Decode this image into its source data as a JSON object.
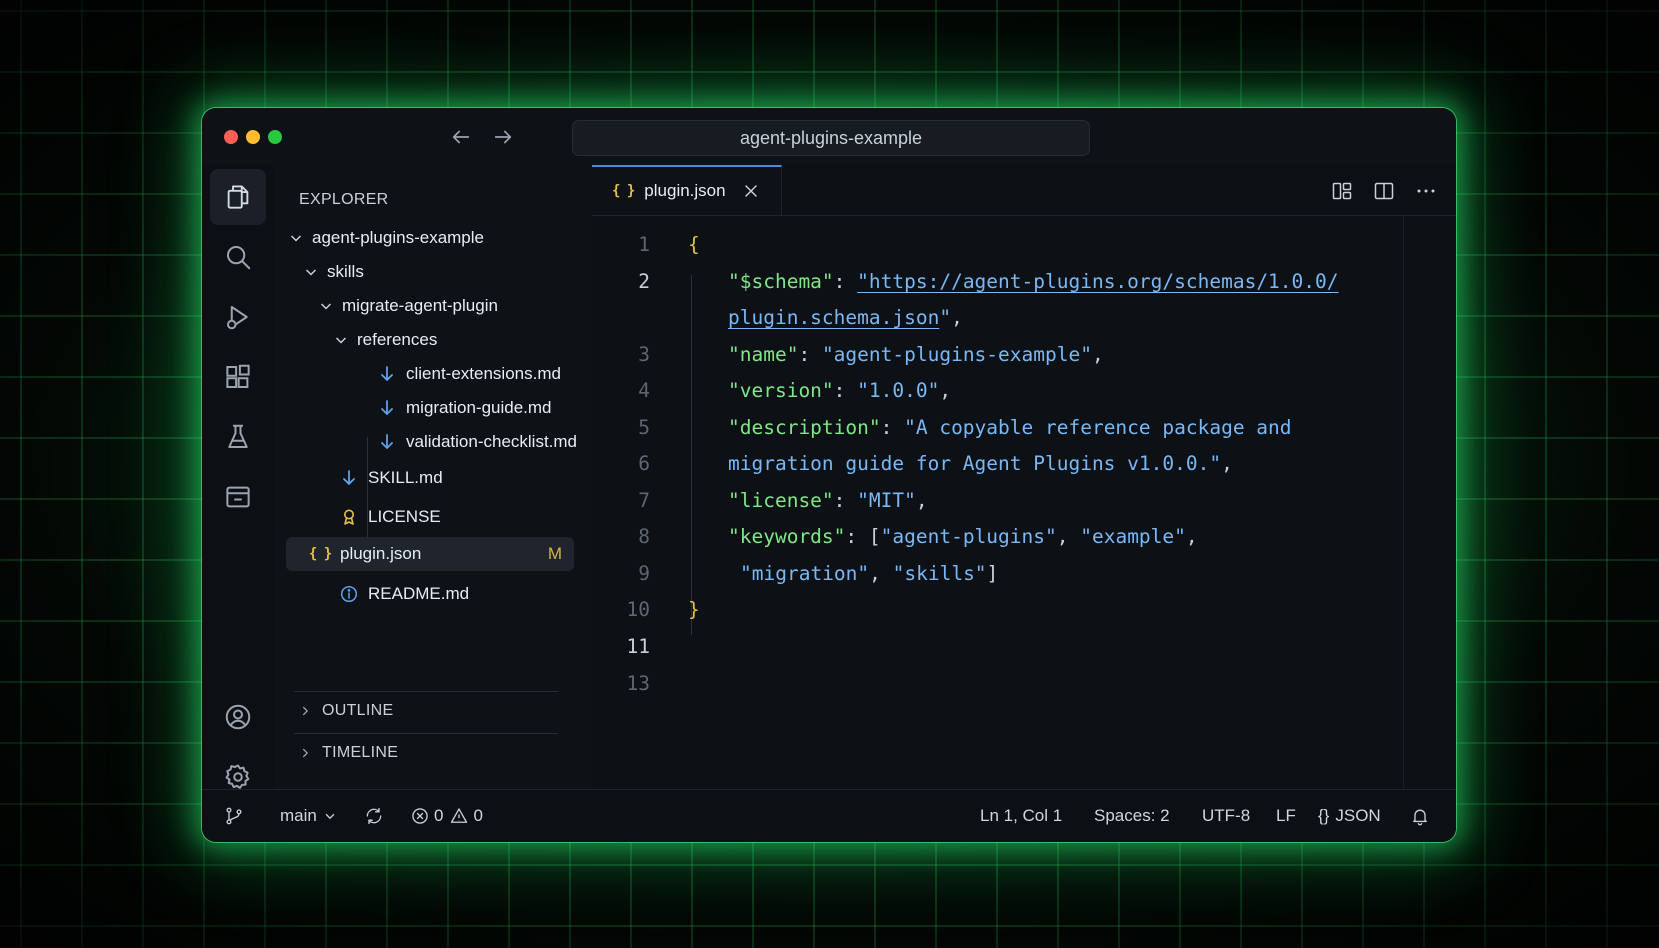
{
  "window": {
    "title": "agent-plugins-example"
  },
  "sidebar": {
    "title": "EXPLORER",
    "tree": [
      {
        "label": "agent-plugins-example",
        "kind": "folder"
      },
      {
        "label": "skills",
        "kind": "folder"
      },
      {
        "label": "migrate-agent-plugin",
        "kind": "folder"
      },
      {
        "label": "references",
        "kind": "folder"
      },
      {
        "label": "client-extensions.md",
        "kind": "markdown"
      },
      {
        "label": "migration-guide.md",
        "kind": "markdown"
      },
      {
        "label": "validation-checklist.md",
        "kind": "markdown"
      },
      {
        "label": "SKILL.md",
        "kind": "markdown"
      },
      {
        "label": "LICENSE",
        "kind": "license"
      },
      {
        "label": "plugin.json",
        "kind": "json",
        "status": "M"
      },
      {
        "label": "README.md",
        "kind": "info"
      }
    ],
    "sections": {
      "outline": "OUTLINE",
      "timeline": "TIMELINE"
    }
  },
  "editor": {
    "tab": {
      "label": "plugin.json",
      "icon": "{}"
    },
    "line_numbers": [
      "1",
      "2",
      "",
      "3",
      "4",
      "5",
      "6",
      "7",
      "8",
      "9",
      "10",
      "11",
      "13"
    ],
    "code": {
      "open": "{",
      "schema_key": "\"$schema\"",
      "schema_val_1": "\"https://agent-plugins.org/schemas/1.0.0/",
      "schema_val_2": "plugin.schema.json",
      "name_key": "\"name\"",
      "name_val": "\"agent-plugins-example\"",
      "version_key": "\"version\"",
      "version_val": "\"1.0.0\"",
      "description_key": "\"description\"",
      "description_val_1": "\"A copyable reference package and",
      "description_val_2": "migration guide for Agent Plugins v1.0.0.\"",
      "license_key": "\"license\"",
      "license_val": "\"MIT\"",
      "keywords_key": "\"keywords\"",
      "kw1": "\"agent-plugins\"",
      "kw2": "\"example\"",
      "kw3": "\"migration\"",
      "kw4": "\"skills\"",
      "close": "}"
    }
  },
  "statusbar": {
    "branch": "main",
    "errors": "0",
    "warnings": "0",
    "cursor": "Ln 1, Col 1",
    "spaces": "Spaces: 2",
    "encoding": "UTF-8",
    "eol": "LF",
    "language": "JSON",
    "language_icon": "{}"
  },
  "icons": {
    "activity": [
      "files-icon",
      "search-icon",
      "run-debug-icon",
      "extensions-icon",
      "testing-icon",
      "remote-explorer-icon",
      "account-icon",
      "settings-gear-icon"
    ]
  },
  "colors": {
    "glow": "#28e070",
    "accent_tab": "#4c8bd8",
    "json_key": "#7ee787",
    "json_string": "#79b8f5",
    "brace": "#e2c04a",
    "modified": "#d7b344"
  }
}
